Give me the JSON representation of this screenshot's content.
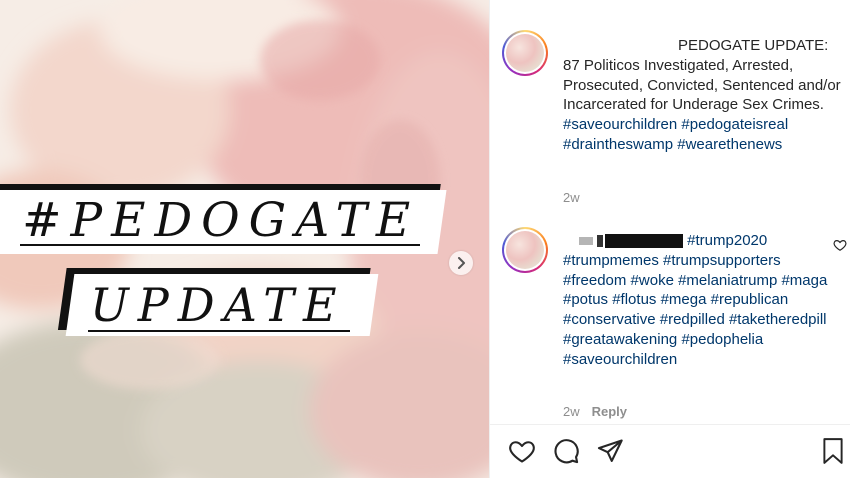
{
  "post": {
    "image": {
      "line1": "#PEDOGATE",
      "line2": "UPDATE",
      "colors": {
        "blush": "#eebcb8",
        "peach": "#f3d2c0",
        "sage": "#cfcabb",
        "cream": "#f6ede6"
      }
    },
    "caption": {
      "text": "PEDOGATE UPDATE: 87 Politicos Investigated, Arrested, Prosecuted, Convicted, Sentenced and/or Incarcerated for Underage Sex Crimes.",
      "hashtags": [
        "#saveourchildren",
        "#pedogateisreal",
        "#draintheswamp",
        "#wearethenews"
      ],
      "time": "2w"
    },
    "comment": {
      "hashtags": [
        "#trump2020",
        "#trumpmemes",
        "#trumpsupporters",
        "#freedom",
        "#woke",
        "#melaniatrump",
        "#maga",
        "#potus",
        "#flotus",
        "#mega",
        "#republican",
        "#conservative",
        "#redpilled",
        "#taketheredpill",
        "#greatawakening",
        "#pedophelia",
        "#saveourchildren"
      ],
      "time": "2w",
      "reply_label": "Reply"
    },
    "icons": {
      "next": "chevron-right-icon",
      "like": "heart-icon",
      "comment": "comment-bubble-icon",
      "share": "paper-plane-icon",
      "save": "bookmark-icon"
    }
  }
}
